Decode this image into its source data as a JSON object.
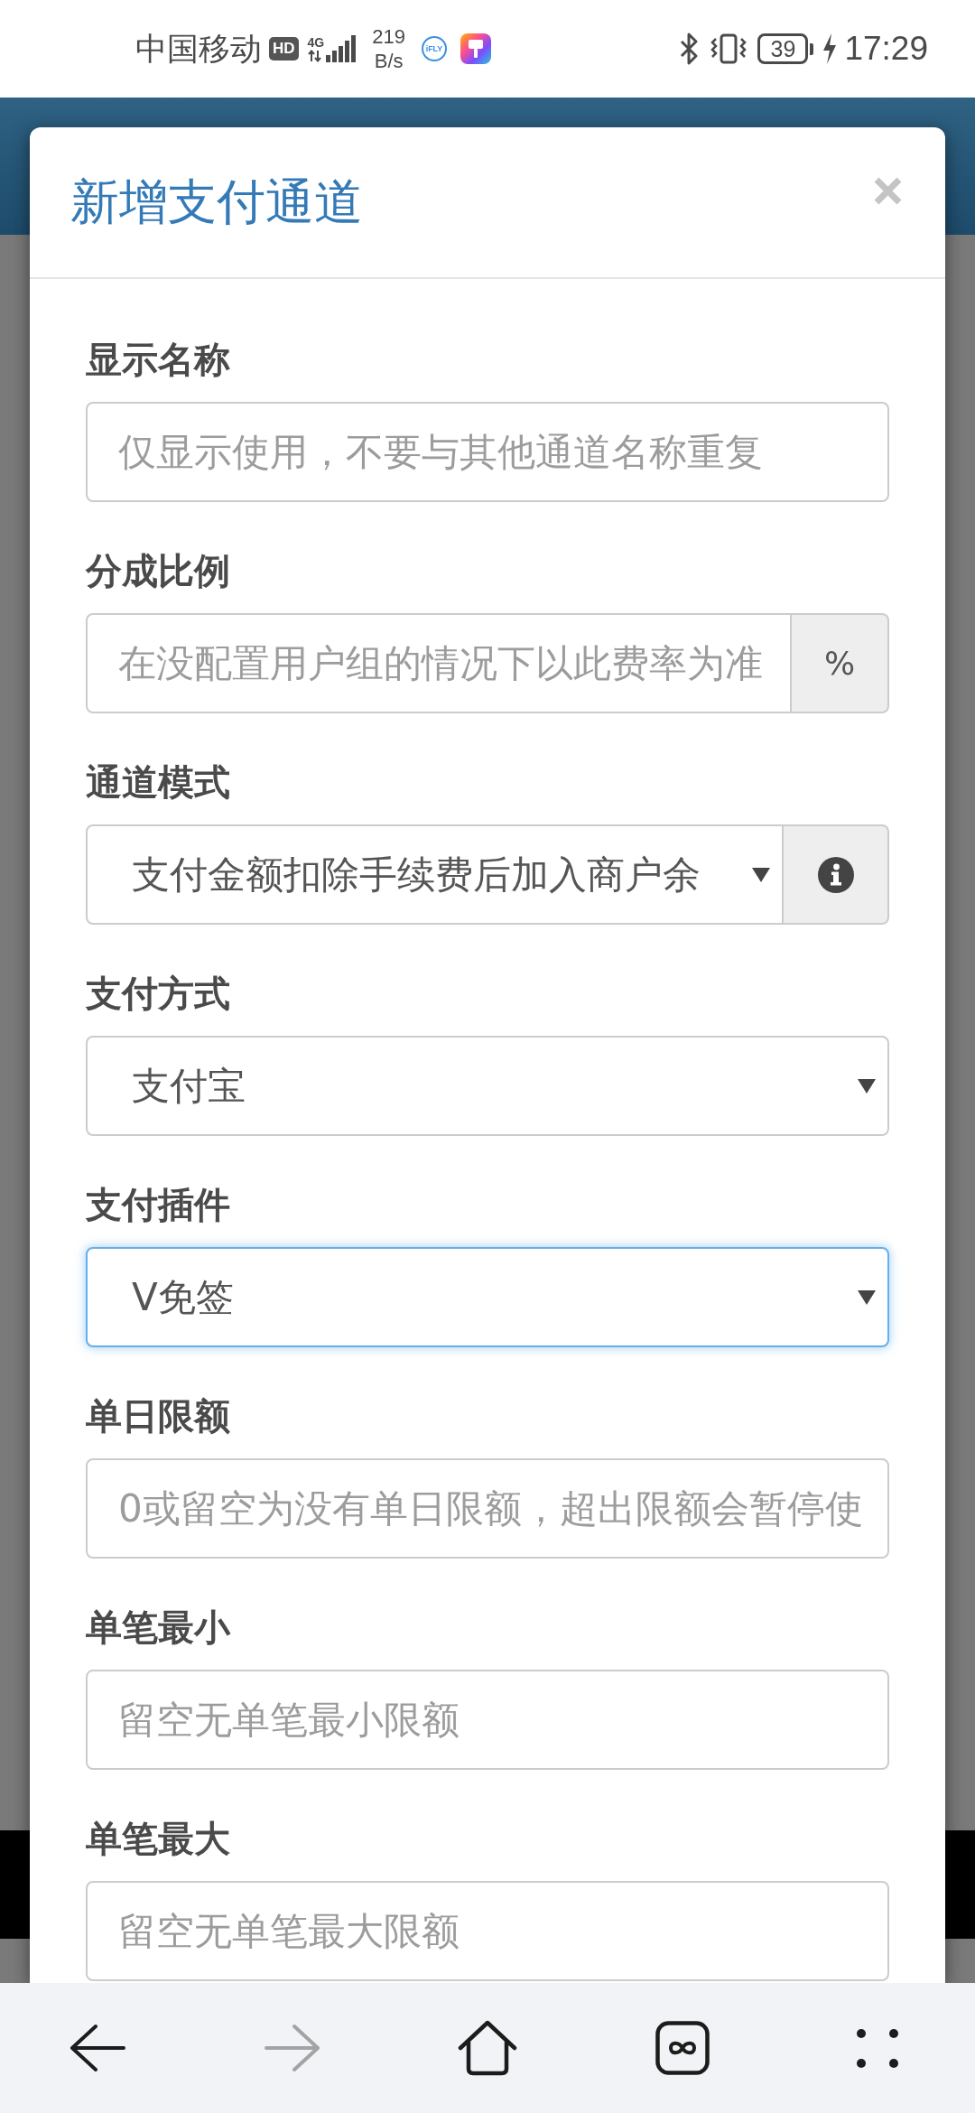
{
  "status_bar": {
    "carrier": "中国移动",
    "hd_badge": "HD",
    "network_type": "4G",
    "speed_value": "219",
    "speed_unit": "B/s",
    "app_icon_text": "iFLY",
    "battery": "39",
    "time": "17:29"
  },
  "dialog": {
    "title": "新增支付通道",
    "fields": [
      {
        "kind": "input",
        "label": "显示名称",
        "placeholder": "仅显示使用，不要与其他通道名称重复",
        "focused": false
      },
      {
        "kind": "input",
        "label": "分成比例",
        "placeholder": "在没配置用户组的情况下以此费率为准",
        "addon": "%",
        "focused": false
      },
      {
        "kind": "select",
        "label": "通道模式",
        "value": "支付金额扣除手续费后加入商户余",
        "info": true,
        "focused": false
      },
      {
        "kind": "select",
        "label": "支付方式",
        "value": "支付宝",
        "focused": false
      },
      {
        "kind": "select",
        "label": "支付插件",
        "value": "V免签",
        "focused": true
      },
      {
        "kind": "input",
        "label": "单日限额",
        "placeholder": "0或留空为没有单日限额，超出限额会暂停使",
        "focused": false
      },
      {
        "kind": "input",
        "label": "单笔最小",
        "placeholder": "留空无单笔最小限额",
        "focused": false
      },
      {
        "kind": "input",
        "label": "单笔最大",
        "placeholder": "留空无单笔最大限额",
        "focused": false
      }
    ]
  },
  "browser_toolbar": {
    "buttons": [
      {
        "kind": "back",
        "disabled": false
      },
      {
        "kind": "forward",
        "disabled": true
      },
      {
        "kind": "home",
        "disabled": false
      },
      {
        "kind": "tabs",
        "disabled": false
      },
      {
        "kind": "menu",
        "disabled": false
      }
    ]
  }
}
